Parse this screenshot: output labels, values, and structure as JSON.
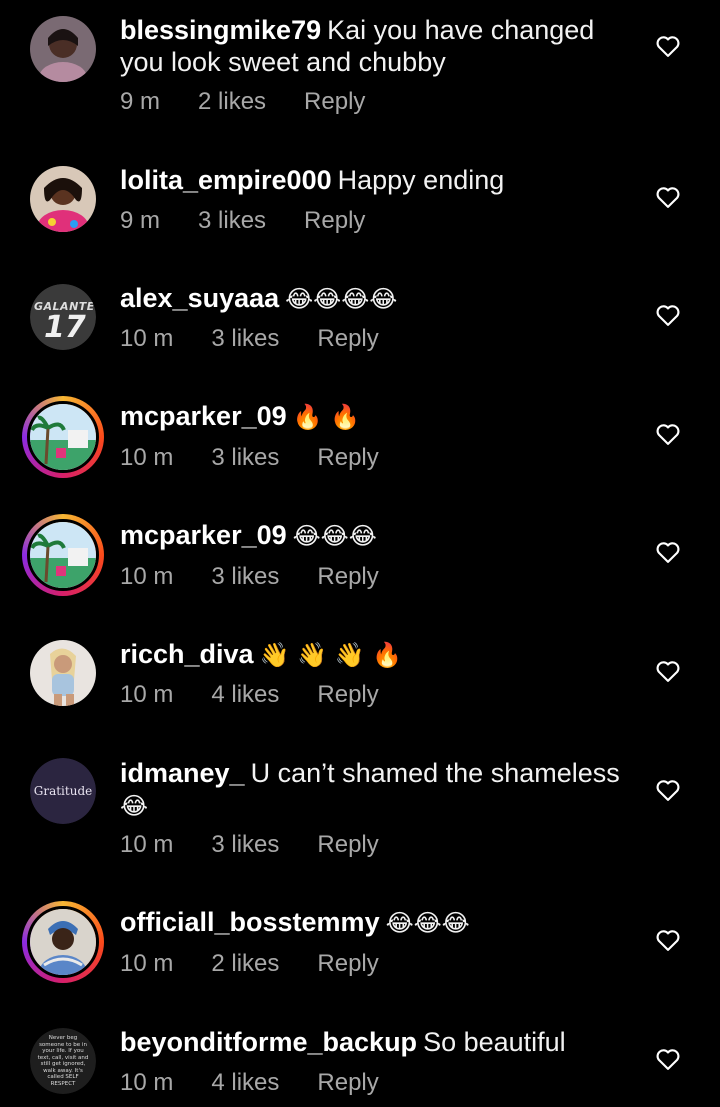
{
  "comments": [
    {
      "username": "blessingmike79",
      "text": "Kai you have changed you look sweet and chubby",
      "emoji": "",
      "time": "9 m",
      "likes": "2 likes",
      "reply": "Reply",
      "avatar": "woman-photo-avatar"
    },
    {
      "username": "lolita_empire000",
      "text": "Happy ending",
      "emoji": "",
      "time": "9 m",
      "likes": "3 likes",
      "reply": "Reply",
      "avatar": "woman-photo-avatar"
    },
    {
      "username": "alex_suyaaa",
      "text": "",
      "emoji": "😂😂😂😂",
      "time": "10 m",
      "likes": "3 likes",
      "reply": "Reply",
      "avatar": "galante-17-avatar",
      "avatar_text": [
        "GALANTE",
        "17"
      ]
    },
    {
      "username": "mcparker_09",
      "text": "",
      "emoji": "🔥 🔥",
      "time": "10 m",
      "likes": "3 likes",
      "reply": "Reply",
      "avatar": "palm-trees-story-avatar"
    },
    {
      "username": "mcparker_09",
      "text": "",
      "emoji": "😂😂😂",
      "time": "10 m",
      "likes": "3 likes",
      "reply": "Reply",
      "avatar": "palm-trees-story-avatar"
    },
    {
      "username": "ricch_diva",
      "text": "",
      "emoji": "👋 👋 👋 🔥",
      "time": "10 m",
      "likes": "4 likes",
      "reply": "Reply",
      "avatar": "woman-photo-avatar"
    },
    {
      "username": "idmaney_",
      "text": "U can’t shamed the shameless",
      "emoji": "😂",
      "time": "10 m",
      "likes": "3 likes",
      "reply": "Reply",
      "avatar": "gratitude-avatar",
      "avatar_text": "Gratitude"
    },
    {
      "username": "officiall_bosstemmy",
      "text": "",
      "emoji": "😂😂😂",
      "time": "10 m",
      "likes": "2 likes",
      "reply": "Reply",
      "avatar": "woman-photo-story-avatar"
    },
    {
      "username": "beyonditforme_backup",
      "text": "So beautiful",
      "emoji": "",
      "time": "10 m",
      "likes": "4 likes",
      "reply": "Reply",
      "avatar": "quote-text-avatar",
      "avatar_text": "Never beg someone to be in your life. If you text, call, visit and still get ignored, walk away. It's called SELF RESPECT"
    }
  ],
  "colors": {
    "background": "#000000",
    "meta": "#a8a8a8",
    "text": "#f2f2f2"
  },
  "icons": {
    "like": "heart-outline-icon"
  }
}
